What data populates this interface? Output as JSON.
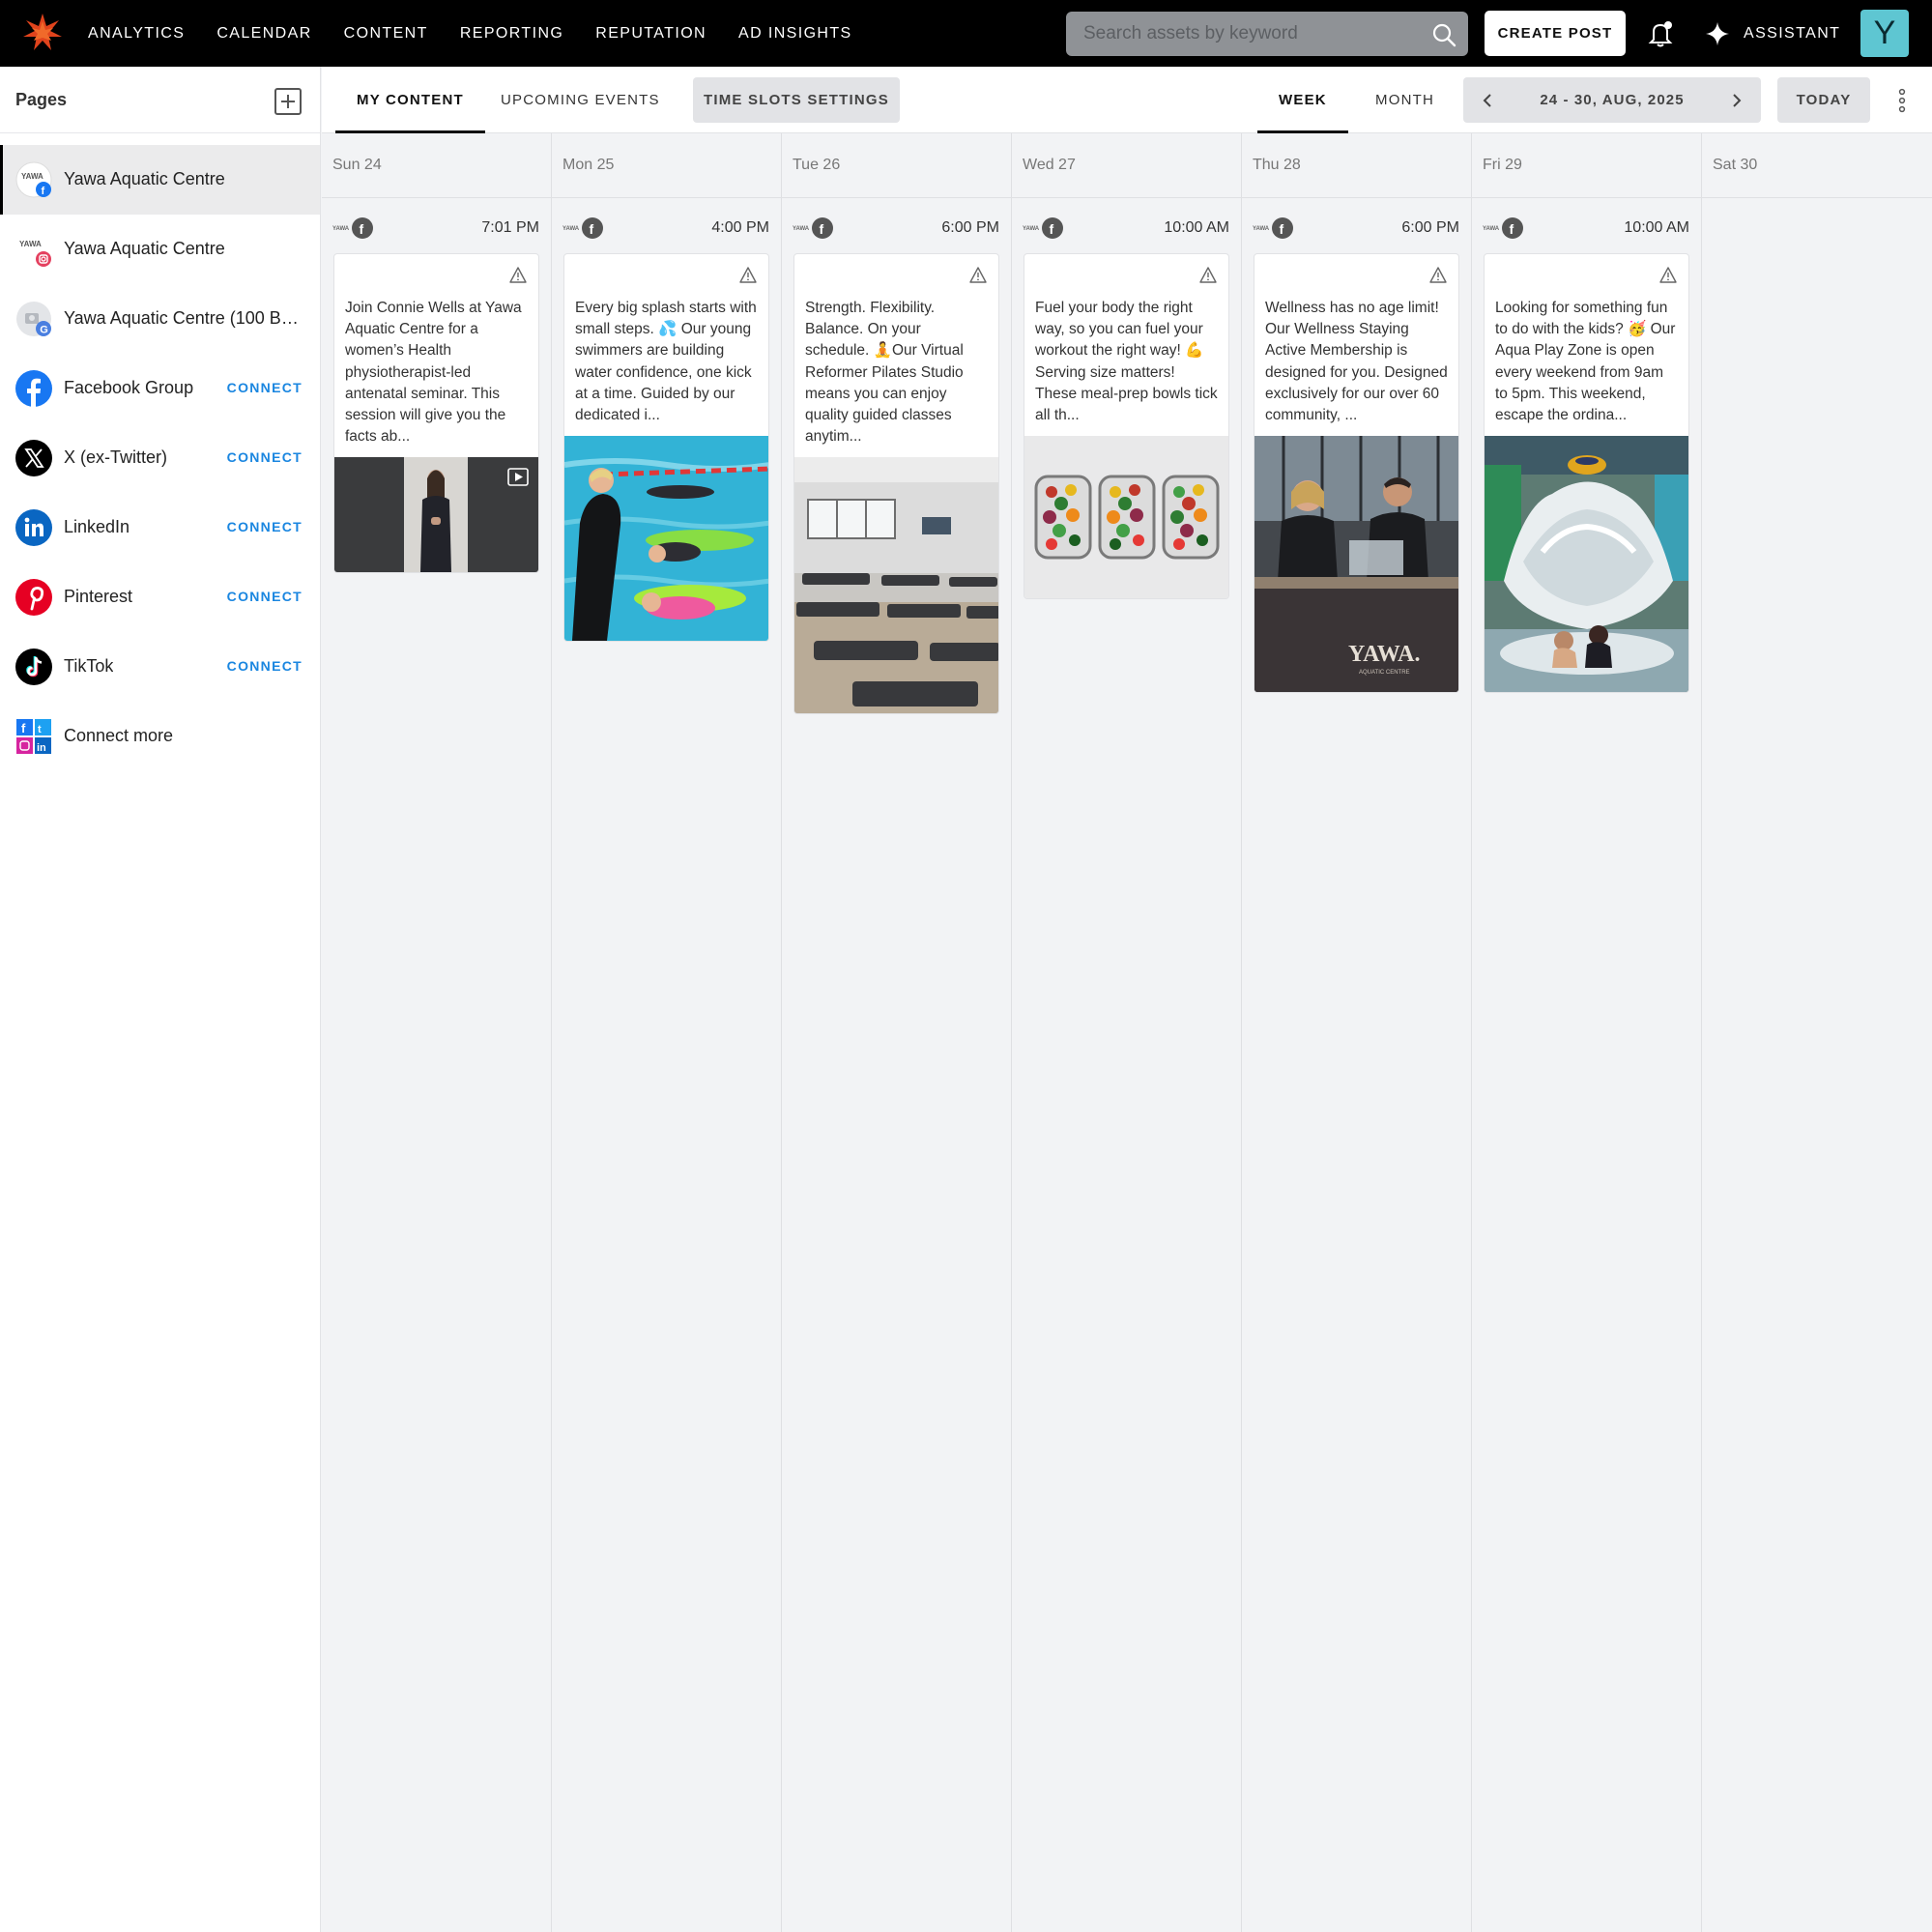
{
  "nav": {
    "items": [
      "ANALYTICS",
      "CALENDAR",
      "CONTENT",
      "REPORTING",
      "REPUTATION",
      "AD INSIGHTS"
    ],
    "search_placeholder": "Search assets by keyword",
    "create_post": "CREATE POST",
    "assistant": "ASSISTANT",
    "avatar_letter": "Y"
  },
  "sidebar": {
    "title": "Pages",
    "items": [
      {
        "label": "Yawa Aquatic Centre",
        "icon": "yawa-facebook-icon",
        "connect": ""
      },
      {
        "label": "Yawa Aquatic Centre",
        "icon": "yawa-instagram-icon",
        "connect": ""
      },
      {
        "label": "Yawa Aquatic Centre (100 Be...",
        "icon": "google-business-icon",
        "connect": ""
      },
      {
        "label": "Facebook Group",
        "icon": "facebook-icon",
        "connect": "CONNECT"
      },
      {
        "label": "X (ex-Twitter)",
        "icon": "x-twitter-icon",
        "connect": "CONNECT"
      },
      {
        "label": "LinkedIn",
        "icon": "linkedin-icon",
        "connect": "CONNECT"
      },
      {
        "label": "Pinterest",
        "icon": "pinterest-icon",
        "connect": "CONNECT"
      },
      {
        "label": "TikTok",
        "icon": "tiktok-icon",
        "connect": "CONNECT"
      },
      {
        "label": "Connect more",
        "icon": "connect-more-icon",
        "connect": ""
      }
    ]
  },
  "toolbar": {
    "tabs": [
      "MY CONTENT",
      "UPCOMING EVENTS"
    ],
    "time_slots": "TIME SLOTS SETTINGS",
    "views": [
      "WEEK",
      "MONTH"
    ],
    "date_range": "24 - 30, AUG, 2025",
    "today": "TODAY"
  },
  "calendar": {
    "days": [
      {
        "label": "Sun 24",
        "post": {
          "time": "7:01 PM",
          "text": "Join Connie Wells at Yawa Aquatic Centre for a women’s Health physiotherapist-led antenatal seminar. This session will give you the facts ab...",
          "image": "video-woman-standing"
        }
      },
      {
        "label": "Mon 25",
        "post": {
          "time": "4:00 PM",
          "text": "Every big splash starts with small steps. 💦 Our young swimmers are building water confidence, one kick at a time. Guided by our dedicated i...",
          "image": "kids-swimming-lesson"
        }
      },
      {
        "label": "Tue 26",
        "post": {
          "time": "6:00 PM",
          "text": "Strength. Flexibility. Balance. On your schedule. 🧘Our Virtual Reformer Pilates Studio means you can enjoy quality guided classes anytim...",
          "image": "pilates-studio"
        }
      },
      {
        "label": "Wed 27",
        "post": {
          "time": "10:00 AM",
          "text": "Fuel your body the right way, so you can fuel your workout the right way! 💪 Serving size matters! These meal-prep bowls tick all th...",
          "image": "meal-prep-bowls"
        }
      },
      {
        "label": "Thu 28",
        "post": {
          "time": "6:00 PM",
          "text": "Wellness has no age limit! Our Wellness Staying Active Membership is designed for you. Designed exclusively for our over 60 community, ...",
          "image": "staff-at-desk",
          "image_text": "YAWA.",
          "image_subtext": "AQUATIC CENTRE"
        }
      },
      {
        "label": "Fri 29",
        "post": {
          "time": "10:00 AM",
          "text": "Looking for something fun to do with the kids? 🥳 Our Aqua Play Zone is open every weekend from 9am to 5pm. This weekend, escape the ordina...",
          "image": "aqua-play-splash"
        }
      },
      {
        "label": "Sat 30"
      }
    ]
  },
  "colors": {
    "accent": "#1a86e0",
    "topbar": "#000000",
    "avatar": "#5ec6d2",
    "logo": "#e0431c"
  }
}
